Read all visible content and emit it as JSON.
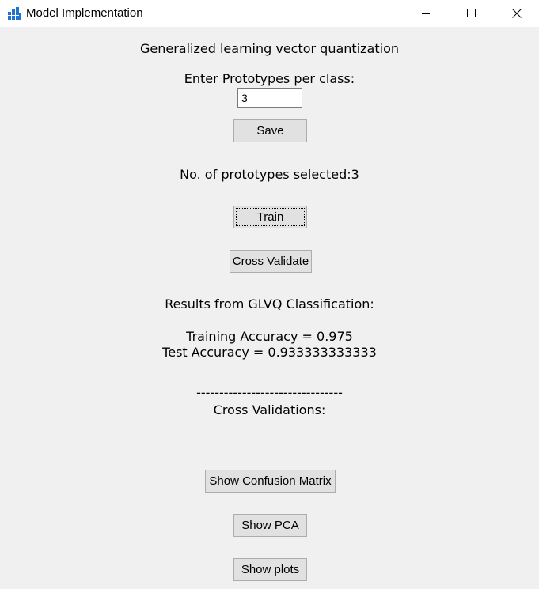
{
  "window": {
    "title": "Model Implementation"
  },
  "heading": "Generalized learning vector quantization",
  "prototypes_prompt": "Enter Prototypes per class:",
  "prototypes_input": {
    "value": "3"
  },
  "buttons": {
    "save": "Save",
    "train": "Train",
    "cross_validate": "Cross Validate",
    "show_confusion_matrix": "Show Confusion Matrix",
    "show_pca": "Show PCA",
    "show_plots": "Show plots"
  },
  "prototypes_selected": "No. of prototypes selected:3",
  "results": {
    "title": "Results from GLVQ Classification:",
    "training_accuracy": "Training Accuracy = 0.975",
    "test_accuracy": "Test Accuracy = 0.933333333333",
    "separator": "--------------------------------",
    "cross_validations": "Cross Validations:"
  },
  "colors": {
    "background": "#f0f0f0",
    "titlebar": "#ffffff",
    "app_icon": "#1e73d2",
    "button_face": "#e1e1e1",
    "button_border": "#adadad"
  }
}
